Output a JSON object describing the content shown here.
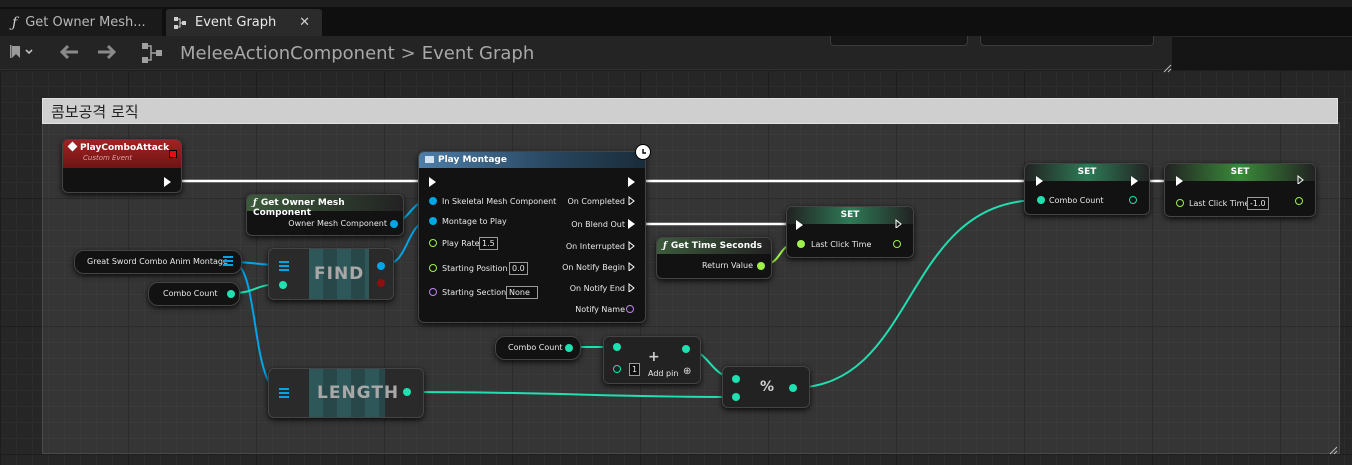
{
  "tabs": [
    {
      "label": "Get Owner Mesh...",
      "icon": "function-icon"
    },
    {
      "label": "Event Graph",
      "icon": "graph-icon",
      "close": "✕"
    }
  ],
  "breadcrumb": {
    "component": "MeleeActionComponent",
    "graph": "Event Graph",
    "separator": ">"
  },
  "comment": {
    "title": "콤보공격 로직"
  },
  "nodes": {
    "event": {
      "title": "PlayComboAttack",
      "subtitle": "Custom Event"
    },
    "getOwnerMesh": {
      "title": "Get Owner Mesh Component",
      "out": "Owner Mesh Component"
    },
    "montageVar": {
      "label": "Great Sword Combo Anim Montage"
    },
    "comboCount1": {
      "label": "Combo Count"
    },
    "find": {
      "label": "FIND"
    },
    "length": {
      "label": "LENGTH"
    },
    "playMontage": {
      "title": "Play Montage",
      "inputs": {
        "mesh": "In Skeletal Mesh Component",
        "montage": "Montage to Play",
        "rate": "Play Rate",
        "rate_val": "1.5",
        "start": "Starting Position",
        "start_val": "0.0",
        "section": "Starting Section",
        "section_val": "None"
      },
      "outputs": {
        "completed": "On Completed",
        "blend": "On Blend Out",
        "interrupted": "On Interrupted",
        "notifyBegin": "On Notify Begin",
        "notifyEnd": "On Notify End",
        "notifyName": "Notify Name"
      }
    },
    "getTime": {
      "title": "Get Time Seconds",
      "out": "Return Value"
    },
    "setLastClick1": {
      "title": "SET",
      "in": "Last Click Time"
    },
    "setCombo": {
      "title": "SET",
      "in": "Combo Count"
    },
    "setLastClick2": {
      "title": "SET",
      "in": "Last Click Time",
      "val": "-1.0"
    },
    "comboCount2": {
      "label": "Combo Count"
    },
    "add": {
      "plus": "+",
      "val": "1",
      "addpin": "Add pin",
      "addpin_icon": "⊕"
    },
    "mod": {
      "label": "%"
    }
  },
  "colors": {
    "exec": "#ffffff",
    "object": "#00a5e6",
    "int": "#1fe0b0",
    "float": "#9ef04b",
    "name": "#c184f0",
    "event_header": "#8c1a1a",
    "set_header": "#2e7a56"
  }
}
